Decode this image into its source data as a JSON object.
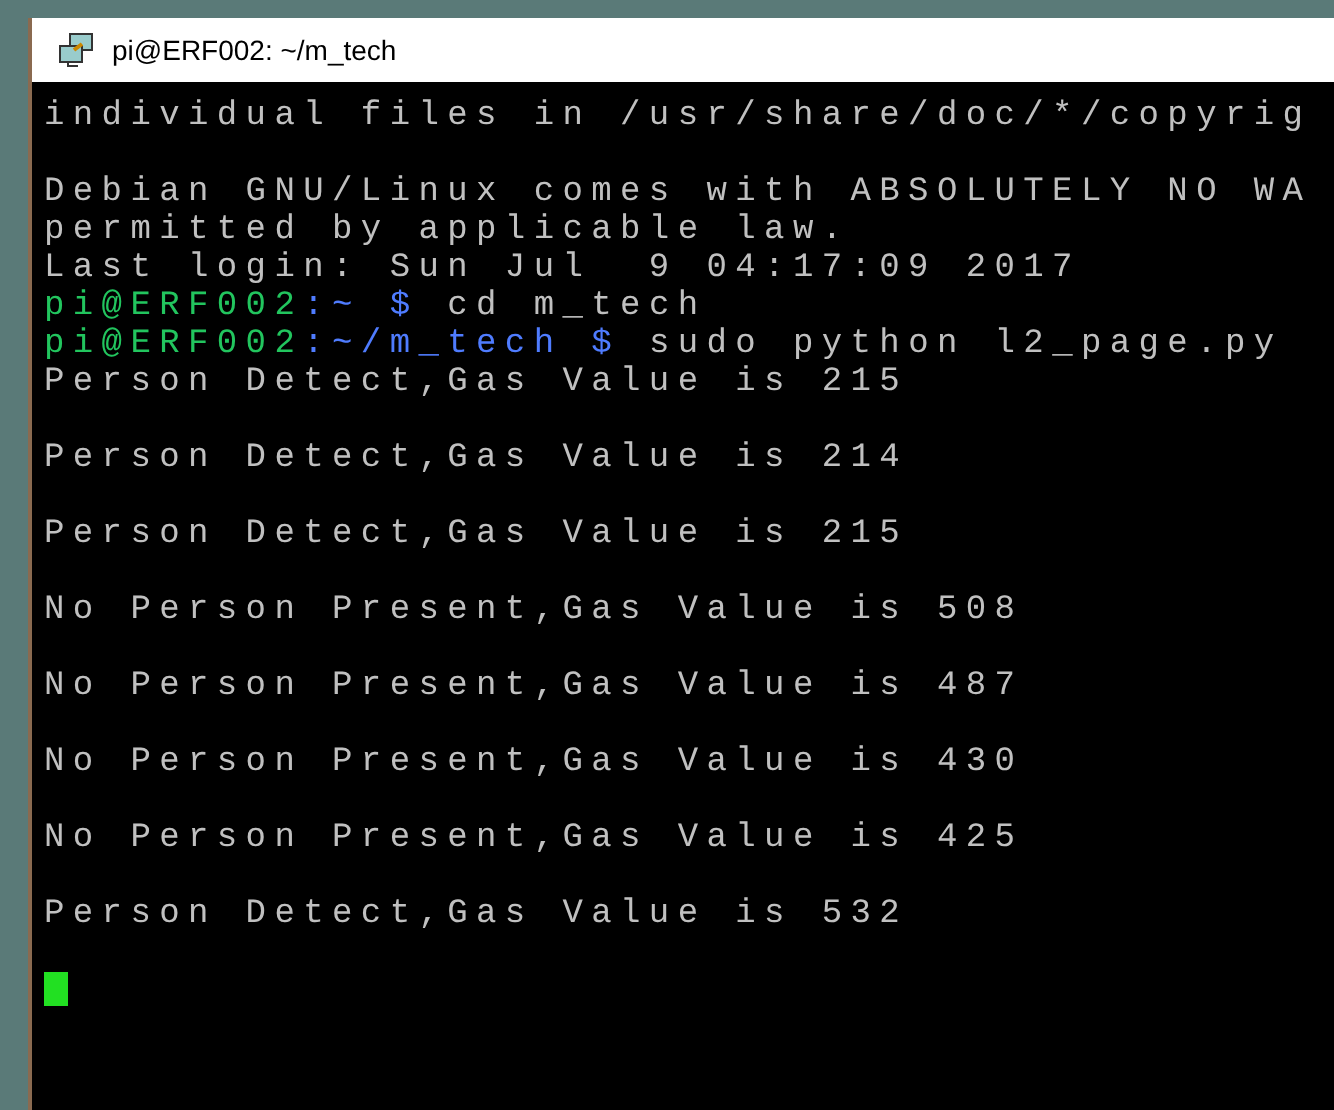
{
  "window": {
    "title": "pi@ERF002: ~/m_tech"
  },
  "terminal": {
    "lines": [
      {
        "kind": "text",
        "segments": [
          {
            "text": "individual files in /usr/share/doc/*/copyrig",
            "color": "#c0c0c0"
          }
        ]
      },
      {
        "kind": "blank"
      },
      {
        "kind": "text",
        "segments": [
          {
            "text": "Debian GNU/Linux comes with ABSOLUTELY NO WA",
            "color": "#c0c0c0"
          }
        ]
      },
      {
        "kind": "text",
        "segments": [
          {
            "text": "permitted by applicable law.",
            "color": "#c0c0c0"
          }
        ]
      },
      {
        "kind": "text",
        "segments": [
          {
            "text": "Last login: Sun Jul  9 04:17:09 2017",
            "color": "#c0c0c0"
          }
        ]
      },
      {
        "kind": "text",
        "segments": [
          {
            "text": "pi@ERF002",
            "color": "#22c55e"
          },
          {
            "text": ":~ $",
            "color": "#4f7cff"
          },
          {
            "text": " cd m_tech",
            "color": "#c0c0c0"
          }
        ]
      },
      {
        "kind": "text",
        "segments": [
          {
            "text": "pi@ERF002",
            "color": "#22c55e"
          },
          {
            "text": ":~/m_tech $",
            "color": "#4f7cff"
          },
          {
            "text": " sudo python l2_page.py",
            "color": "#c0c0c0"
          }
        ]
      },
      {
        "kind": "text",
        "segments": [
          {
            "text": "Person Detect,Gas Value is 215",
            "color": "#c0c0c0"
          }
        ]
      },
      {
        "kind": "blank"
      },
      {
        "kind": "text",
        "segments": [
          {
            "text": "Person Detect,Gas Value is 214",
            "color": "#c0c0c0"
          }
        ]
      },
      {
        "kind": "blank"
      },
      {
        "kind": "text",
        "segments": [
          {
            "text": "Person Detect,Gas Value is 215",
            "color": "#c0c0c0"
          }
        ]
      },
      {
        "kind": "blank"
      },
      {
        "kind": "text",
        "segments": [
          {
            "text": "No Person Present,Gas Value is 508",
            "color": "#c0c0c0"
          }
        ]
      },
      {
        "kind": "blank"
      },
      {
        "kind": "text",
        "segments": [
          {
            "text": "No Person Present,Gas Value is 487",
            "color": "#c0c0c0"
          }
        ]
      },
      {
        "kind": "blank"
      },
      {
        "kind": "text",
        "segments": [
          {
            "text": "No Person Present,Gas Value is 430",
            "color": "#c0c0c0"
          }
        ]
      },
      {
        "kind": "blank"
      },
      {
        "kind": "text",
        "segments": [
          {
            "text": "No Person Present,Gas Value is 425",
            "color": "#c0c0c0"
          }
        ]
      },
      {
        "kind": "blank"
      },
      {
        "kind": "text",
        "segments": [
          {
            "text": "Person Detect,Gas Value is 532",
            "color": "#c0c0c0"
          }
        ]
      },
      {
        "kind": "blank"
      },
      {
        "kind": "cursor"
      }
    ]
  }
}
